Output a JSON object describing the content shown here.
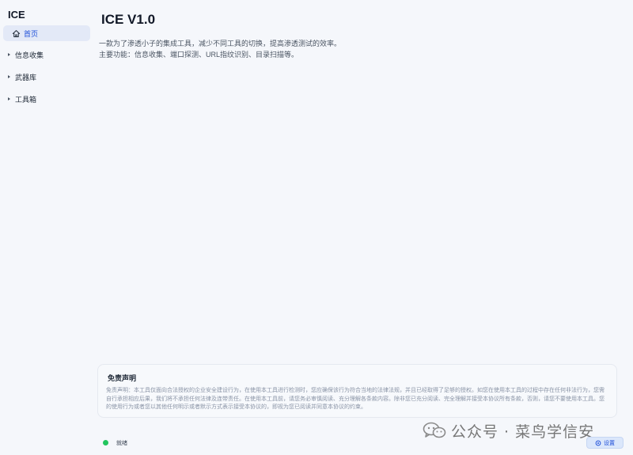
{
  "app": {
    "title": "ICE"
  },
  "sidebar": {
    "items": [
      {
        "label": "首页",
        "icon": "home-icon",
        "active": true
      },
      {
        "label": "信息收集",
        "icon": "caret-right-icon"
      },
      {
        "label": "武器库",
        "icon": "caret-right-icon"
      },
      {
        "label": "工具箱",
        "icon": "caret-right-icon"
      }
    ]
  },
  "main": {
    "title": "ICE V1.0",
    "description": [
      "一款为了渗透小子的集成工具，减少不同工具的切换，提高渗透测试的效率。",
      "主要功能：信息收集、端口探测、URL指纹识别、目录扫描等。"
    ]
  },
  "disclaimer": {
    "title": "免责声明",
    "text": "免责声明：本工具仅面向合法授权的企业安全建设行为，在使用本工具进行检测时，您应确保该行为符合当地的法律法规，并且已经取得了足够的授权。如您在使用本工具的过程中存在任何非法行为，您需自行承担相应后果，我们将不承担任何法律及连带责任。在使用本工具前，请您务必审慎阅读、充分理解各条款内容。除非您已充分阅读、完全理解并接受本协议所有条款，否则，请您不要使用本工具。您的使用行为或者您以其他任何明示或者默示方式表示接受本协议的，即视为您已阅读并同意本协议的约束。"
  },
  "status": {
    "text": "就绪",
    "color": "#22c55e"
  },
  "settings": {
    "label": "设置",
    "icon": "gear-icon"
  },
  "watermark": {
    "text": "公众号 · 菜鸟学信安",
    "icon": "wechat-icon"
  },
  "colors": {
    "accent": "#1d4ed8",
    "active_bg": "#e3e9f7",
    "background": "#f5f7fb"
  }
}
